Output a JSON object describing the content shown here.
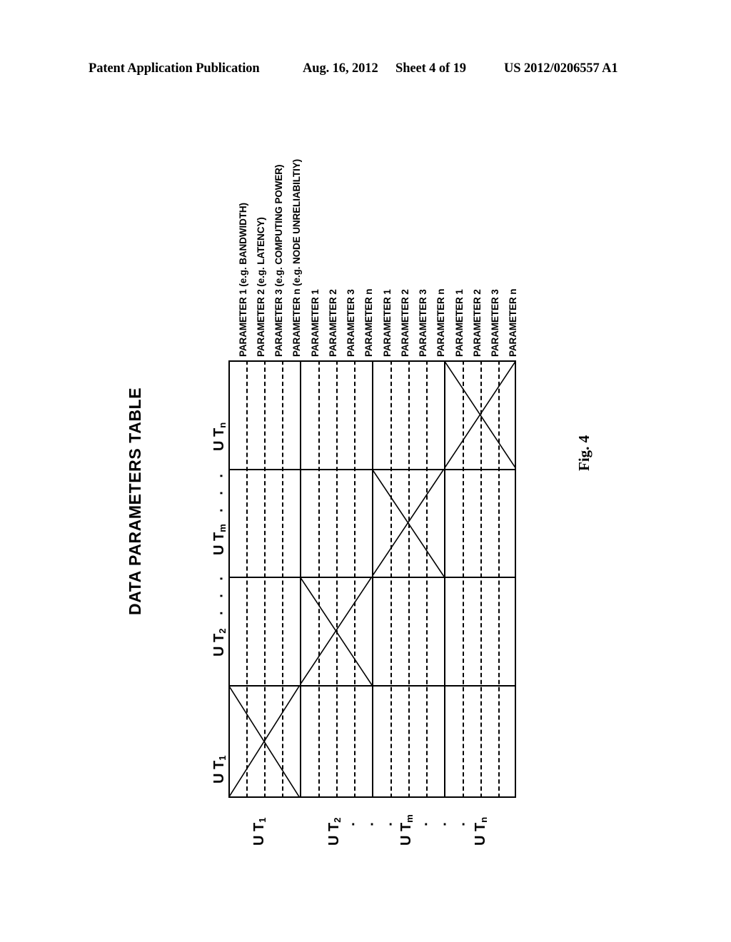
{
  "header": {
    "publication": "Patent Application Publication",
    "date": "Aug. 16, 2012",
    "sheet": "Sheet 4 of 19",
    "number": "US 2012/0206557 A1"
  },
  "figure": {
    "label": "Fig. 4",
    "title": "DATA PARAMETERS TABLE"
  },
  "table": {
    "column_groups": [
      {
        "label": "U T",
        "sub": "1",
        "parameters": [
          "PARAMETER 1 (e.g. BANDWIDTH)",
          "PARAMETER 2 (e.g. LATENCY)",
          "PARAMETER 3 (e.g. COMPUTING POWER)",
          "PARAMETER n (e.g. NODE UNRELIABILTIY)"
        ]
      },
      {
        "label": "U T",
        "sub": "2",
        "parameters": [
          "PARAMETER 1",
          "PARAMETER 2",
          "PARAMETER 3",
          "PARAMETER n"
        ]
      },
      {
        "label": "U T",
        "sub": "m",
        "parameters": [
          "PARAMETER 1",
          "PARAMETER 2",
          "PARAMETER 3",
          "PARAMETER n"
        ]
      },
      {
        "label": "U T",
        "sub": "n",
        "parameters": [
          "PARAMETER 1",
          "PARAMETER 2",
          "PARAMETER 3",
          "PARAMETER n"
        ]
      }
    ],
    "row_groups": [
      {
        "label": "U T",
        "sub": "1"
      },
      {
        "label": "U T",
        "sub": "2"
      },
      {
        "label": "U T",
        "sub": "m"
      },
      {
        "label": "U T",
        "sub": "n"
      }
    ],
    "ellipsis": "·  ·  ·",
    "diagonal_cells": [
      {
        "row": 0,
        "group": 3
      },
      {
        "row": 1,
        "group": 2
      },
      {
        "row": 2,
        "group": 1
      },
      {
        "row": 3,
        "group": 0
      }
    ]
  },
  "colors": {
    "ink": "#000000",
    "paper": "#ffffff"
  }
}
